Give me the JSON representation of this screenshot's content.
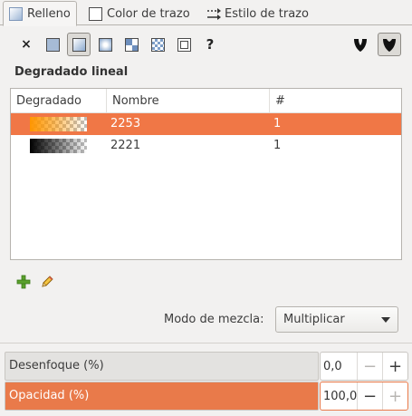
{
  "tabs": [
    {
      "label": "Relleno",
      "icon": "fill-icon",
      "active": true
    },
    {
      "label": "Color de trazo",
      "icon": "stroke-paint-icon",
      "active": false
    },
    {
      "label": "Estilo de trazo",
      "icon": "stroke-style-icon",
      "active": false
    }
  ],
  "paint_types": [
    {
      "name": "no-paint",
      "glyph": "×"
    },
    {
      "name": "flat-color"
    },
    {
      "name": "linear-gradient",
      "selected": true
    },
    {
      "name": "radial-gradient"
    },
    {
      "name": "pattern"
    },
    {
      "name": "swatch"
    },
    {
      "name": "mesh"
    },
    {
      "name": "unset",
      "glyph": "?"
    }
  ],
  "fill_rules": [
    {
      "name": "evenodd",
      "selected": false
    },
    {
      "name": "nonzero",
      "selected": true
    }
  ],
  "section_title": "Degradado lineal",
  "table": {
    "headers": [
      "Degradado",
      "Nombre",
      "#"
    ],
    "rows": [
      {
        "name": "2253",
        "count": "1",
        "selected": true,
        "color": "#ff9600"
      },
      {
        "name": "2221",
        "count": "1",
        "selected": false,
        "color": "#000000"
      }
    ]
  },
  "blend": {
    "label": "Modo de mezcla:",
    "value": "Multiplicar"
  },
  "blur": {
    "label": "Desenfoque (%)",
    "value": "0,0",
    "fraction": 0.0
  },
  "opacity": {
    "label": "Opacidad (%)",
    "value": "100,0",
    "fraction": 1.0
  },
  "colors": {
    "accent": "#f07746",
    "background": "#f2f1f0"
  }
}
